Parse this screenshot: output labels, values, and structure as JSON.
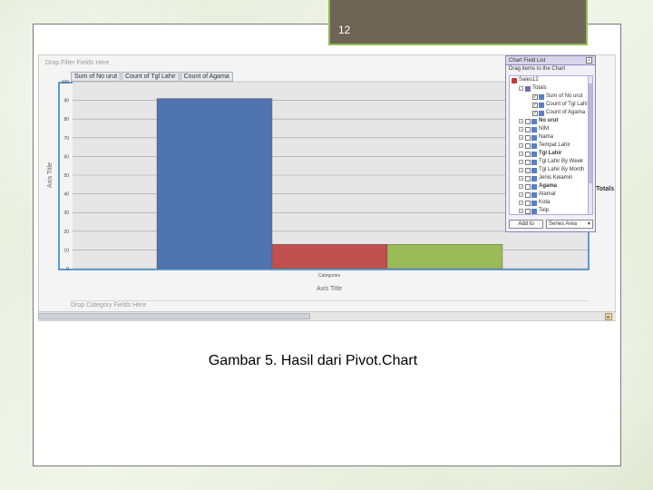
{
  "slide": {
    "page_number": "12",
    "caption": "Gambar 5. Hasil dari Pivot.Chart"
  },
  "excel": {
    "drop_filter_label": "Drop Filter Fields Here",
    "drop_category_label": "Drop Category Fields Here",
    "field_buttons": [
      "Sum of No urut",
      "Count of Tgl Lahir",
      "Count of Agama"
    ],
    "totals_label": "Totals"
  },
  "chart_data": {
    "type": "bar",
    "categories": [
      "Categories"
    ],
    "series": [
      {
        "name": "Sum of No urut",
        "values": [
          91
        ],
        "color": "#4f74b0"
      },
      {
        "name": "Count of Tgl Lahir",
        "values": [
          13
        ],
        "color": "#c0504d"
      },
      {
        "name": "Count of Agama",
        "values": [
          13
        ],
        "color": "#9bbb59"
      }
    ],
    "ylim": [
      0,
      100
    ],
    "yticks": [
      0,
      10,
      20,
      30,
      40,
      50,
      60,
      70,
      80,
      90,
      100
    ],
    "xlabel": "Axis Title",
    "ylabel": "Axis Title",
    "grid": true
  },
  "field_list": {
    "title": "Chart Field List",
    "subtitle": "Drag items to the Chart",
    "items": [
      {
        "label": "Sales12",
        "level": 0,
        "kind": "db",
        "checked": false,
        "bold": false,
        "expand": ""
      },
      {
        "label": "Totals",
        "level": 1,
        "kind": "group",
        "checked": false,
        "bold": false,
        "expand": "-"
      },
      {
        "label": "Sum of No urut",
        "level": 2,
        "kind": "value",
        "checked": true,
        "bold": false,
        "expand": ""
      },
      {
        "label": "Count of Tgl Lahir",
        "level": 2,
        "kind": "value",
        "checked": true,
        "bold": false,
        "expand": ""
      },
      {
        "label": "Count of Agama",
        "level": 2,
        "kind": "value",
        "checked": true,
        "bold": false,
        "expand": ""
      },
      {
        "label": "No urut",
        "level": 1,
        "kind": "field",
        "checked": false,
        "bold": true,
        "expand": "+"
      },
      {
        "label": "NIM",
        "level": 1,
        "kind": "field",
        "checked": false,
        "bold": false,
        "expand": "+"
      },
      {
        "label": "Nama",
        "level": 1,
        "kind": "field",
        "checked": false,
        "bold": false,
        "expand": "+"
      },
      {
        "label": "Tempat Lahir",
        "level": 1,
        "kind": "field",
        "checked": false,
        "bold": false,
        "expand": "+"
      },
      {
        "label": "Tgl Lahir",
        "level": 1,
        "kind": "field",
        "checked": false,
        "bold": true,
        "expand": "+"
      },
      {
        "label": "Tgl Lahir By Week",
        "level": 1,
        "kind": "field",
        "checked": false,
        "bold": false,
        "expand": "+"
      },
      {
        "label": "Tgl Lahir By Month",
        "level": 1,
        "kind": "field",
        "checked": false,
        "bold": false,
        "expand": "+"
      },
      {
        "label": "Jenis Kelamin",
        "level": 1,
        "kind": "field",
        "checked": false,
        "bold": false,
        "expand": "+"
      },
      {
        "label": "Agama",
        "level": 1,
        "kind": "field",
        "checked": false,
        "bold": true,
        "expand": "+"
      },
      {
        "label": "Alamat",
        "level": 1,
        "kind": "field",
        "checked": false,
        "bold": false,
        "expand": "+"
      },
      {
        "label": "Kota",
        "level": 1,
        "kind": "field",
        "checked": false,
        "bold": false,
        "expand": "+"
      },
      {
        "label": "Telp",
        "level": 1,
        "kind": "field",
        "checked": false,
        "bold": false,
        "expand": "+"
      }
    ],
    "add_to_label": "Add to",
    "area_select_value": "Series Area"
  },
  "colors": {
    "accent_green": "#8fbf52",
    "tab_brown": "#6d6456",
    "chart_border": "#5b9bd5"
  }
}
